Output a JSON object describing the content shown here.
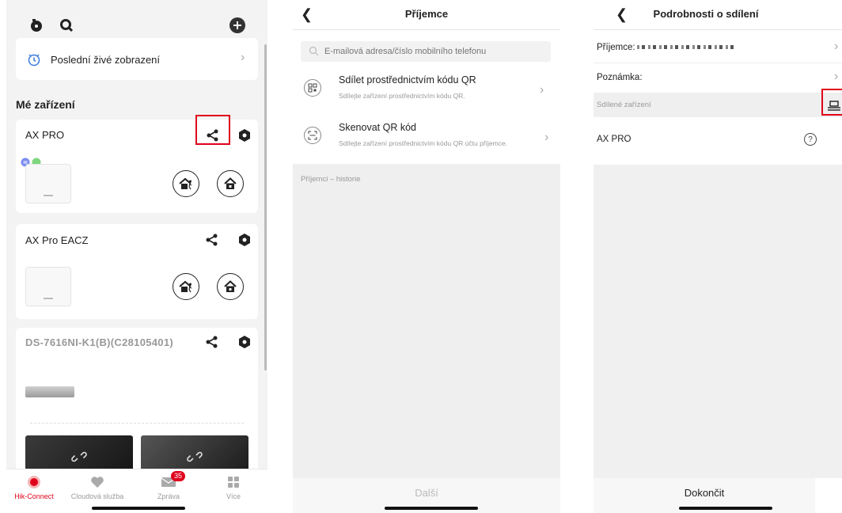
{
  "panel1": {
    "last_live_view_label": "Poslední živé zobrazení",
    "section_title": "Mé zařízení",
    "devices": [
      {
        "name": "AX PRO"
      },
      {
        "name": "AX Pro  EACZ"
      },
      {
        "name": "DS-7616NI-K1(B)(C28105401)"
      }
    ],
    "tabs": [
      {
        "label": "Hik-Connect",
        "icon": "hik-connect-icon",
        "active": true
      },
      {
        "label": "Cloudová služba",
        "icon": "cloud-heart-icon"
      },
      {
        "label": "Zpráva",
        "icon": "mail-icon",
        "badge": "35"
      },
      {
        "label": "Více",
        "icon": "grid-icon"
      }
    ]
  },
  "panel2": {
    "title": "Příjemce",
    "search_placeholder": "E-mailová adresa/číslo mobilního telefonu",
    "options": [
      {
        "title": "Sdílet prostřednictvím kódu QR",
        "subtitle": "Sdílejte zařízení prostřednictvím kódu QR.",
        "icon": "qr-code-icon"
      },
      {
        "title": "Skenovat QR kód",
        "subtitle": "Sdílejte zařízení prostřednictvím kódu QR účtu příjemce.",
        "icon": "scan-icon"
      }
    ],
    "history_label": "Příjemci – historie",
    "next_button": "Další"
  },
  "panel3": {
    "title": "Podrobnosti o sdílení",
    "recipient_label": "Příjemce:",
    "note_label": "Poznámka:",
    "shared_devices_label": "Sdílené zařízení",
    "device_name": "AX PRO",
    "finish_button": "Dokončit"
  },
  "colors": {
    "accent_red": "#e0001a",
    "background_gray": "#f3f3f3"
  }
}
